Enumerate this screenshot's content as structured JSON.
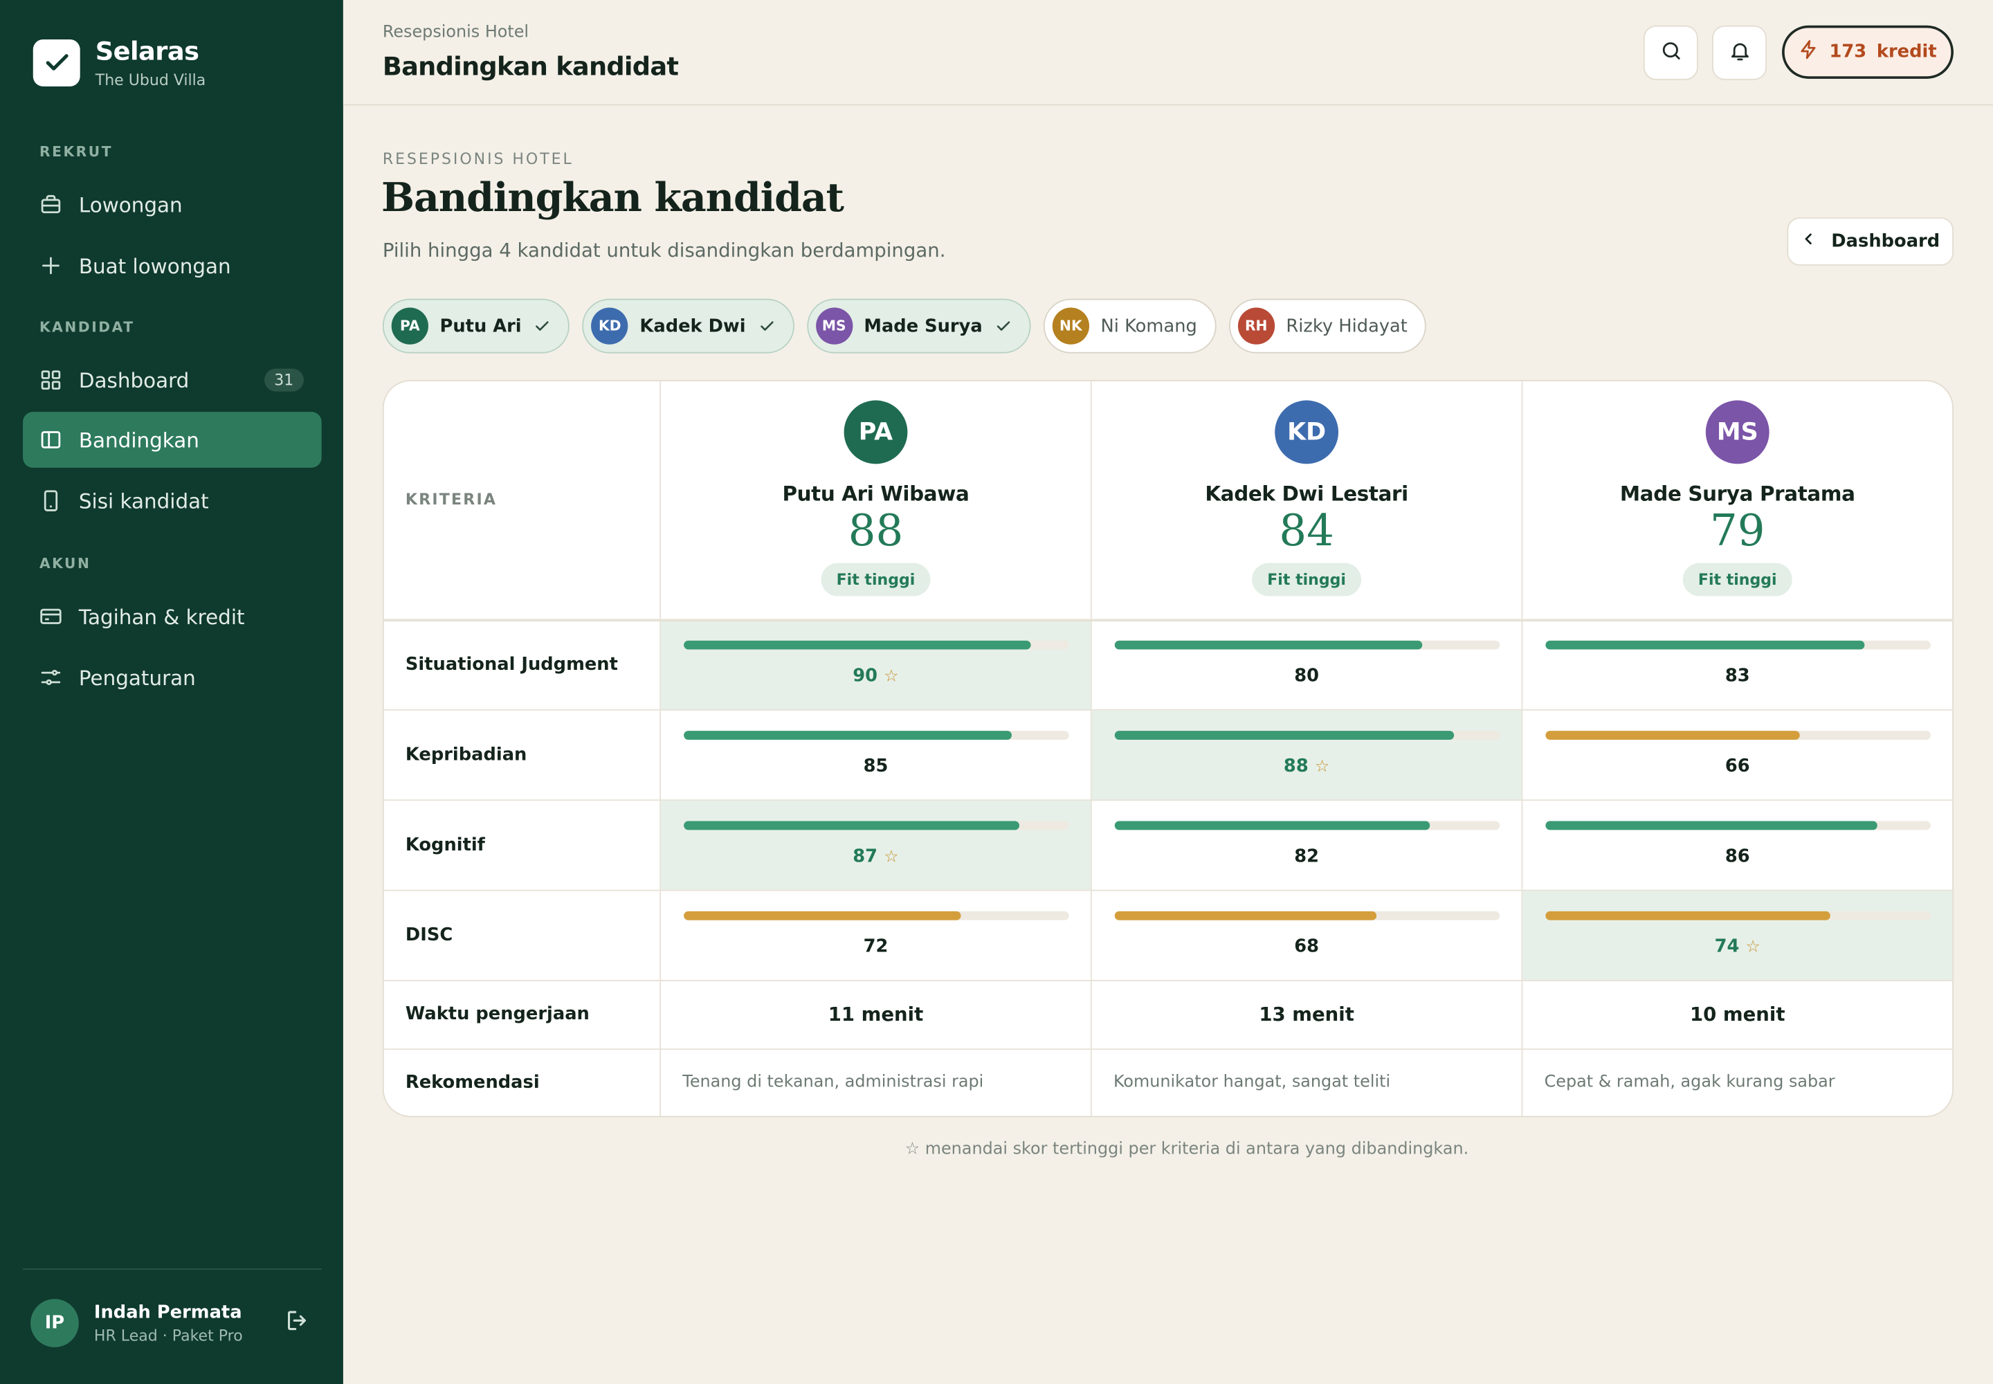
{
  "colors": {
    "sidebar_bg": "#0f3a2e",
    "accent_green": "#237a58",
    "bar_green": "#3a9a74",
    "bar_amber": "#d49e3d",
    "credit_text": "#b24a1d"
  },
  "sidebar": {
    "brand_name": "Selaras",
    "brand_sub": "The Ubud Villa",
    "sections": {
      "rekrut": "REKRUT",
      "kandidat": "KANDIDAT",
      "akun": "AKUN"
    },
    "items": [
      {
        "label": "Lowongan",
        "icon": "briefcase-icon"
      },
      {
        "label": "Buat lowongan",
        "icon": "plus-icon"
      },
      {
        "label": "Dashboard",
        "icon": "grid-icon",
        "badge": "31"
      },
      {
        "label": "Bandingkan",
        "icon": "columns-icon",
        "active": true
      },
      {
        "label": "Sisi kandidat",
        "icon": "phone-icon"
      },
      {
        "label": "Tagihan & kredit",
        "icon": "card-icon"
      },
      {
        "label": "Pengaturan",
        "icon": "sliders-icon"
      }
    ],
    "user": {
      "initials": "IP",
      "name": "Indah Permata",
      "role": "HR Lead · Paket Pro"
    }
  },
  "topbar": {
    "breadcrumb": "Resepsionis Hotel",
    "title": "Bandingkan kandidat",
    "credits": "173",
    "credits_unit": "kredit"
  },
  "main": {
    "eyebrow": "RESEPSIONIS HOTEL",
    "title": "Bandingkan kandidat",
    "subtitle": "Pilih hingga 4 kandidat untuk disandingkan berdampingan.",
    "back_label": "Dashboard",
    "chips": [
      {
        "initials": "PA",
        "label": "Putu Ari",
        "selected": true,
        "color": "#1f6b52"
      },
      {
        "initials": "KD",
        "label": "Kadek Dwi",
        "selected": true,
        "color": "#3d6cae"
      },
      {
        "initials": "MS",
        "label": "Made Surya",
        "selected": true,
        "color": "#7b55a8"
      },
      {
        "initials": "NK",
        "label": "Ni Komang",
        "selected": false,
        "color": "#b5801f"
      },
      {
        "initials": "RH",
        "label": "Rizky Hidayat",
        "selected": false,
        "color": "#b94a36"
      }
    ],
    "table": {
      "kriteria_label": "KRITERIA",
      "candidates": [
        {
          "initials": "PA",
          "name": "Putu Ari Wibawa",
          "score": "88",
          "fit": "Fit tinggi",
          "color": "#1f6b52"
        },
        {
          "initials": "KD",
          "name": "Kadek Dwi Lestari",
          "score": "84",
          "fit": "Fit tinggi",
          "color": "#3d6cae"
        },
        {
          "initials": "MS",
          "name": "Made Surya Pratama",
          "score": "79",
          "fit": "Fit tinggi",
          "color": "#7b55a8"
        }
      ],
      "rows": [
        {
          "label": "Situational Judgment",
          "values": [
            90,
            80,
            83
          ],
          "best": 0,
          "colors": [
            "#3a9a74",
            "#3a9a74",
            "#3a9a74"
          ]
        },
        {
          "label": "Kepribadian",
          "values": [
            85,
            88,
            66
          ],
          "best": 1,
          "colors": [
            "#3a9a74",
            "#3a9a74",
            "#d49e3d"
          ]
        },
        {
          "label": "Kognitif",
          "values": [
            87,
            82,
            86
          ],
          "best": 0,
          "colors": [
            "#3a9a74",
            "#3a9a74",
            "#3a9a74"
          ]
        },
        {
          "label": "DISC",
          "values": [
            72,
            68,
            74
          ],
          "best": 2,
          "colors": [
            "#d49e3d",
            "#d49e3d",
            "#d49e3d"
          ]
        }
      ],
      "time": {
        "label": "Waktu pengerjaan",
        "values": [
          "11 menit",
          "13 menit",
          "10 menit"
        ]
      },
      "recommendation": {
        "label": "Rekomendasi",
        "values": [
          "Tenang di tekanan, administrasi rapi",
          "Komunikator hangat, sangat teliti",
          "Cepat & ramah, agak kurang sabar"
        ]
      }
    },
    "footnote": "☆ menandai skor tertinggi per kriteria di antara yang dibandingkan."
  }
}
